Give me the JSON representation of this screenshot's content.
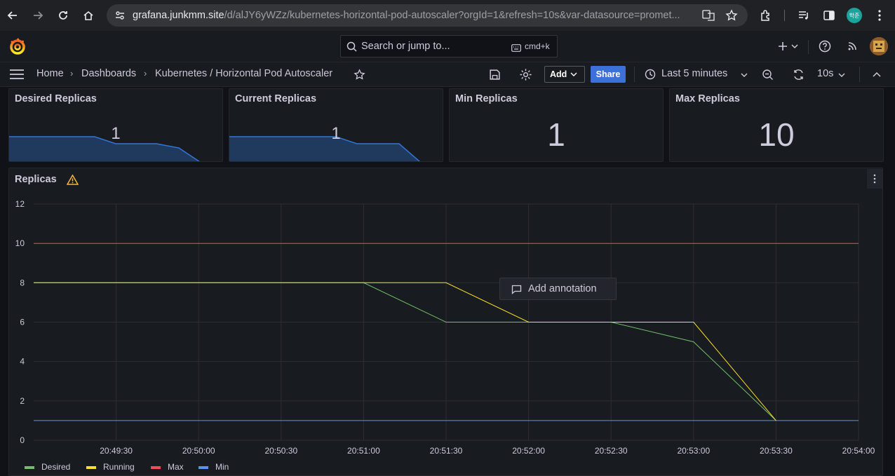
{
  "browser": {
    "url_host": "grafana.junkmm.site",
    "url_path": "/d/alJY6yWZz/kubernetes-horizontal-pod-autoscaler?orgId=1&refresh=10s&var-datasource=promet...",
    "profile_initials": "학준"
  },
  "topbar": {
    "search_placeholder": "Search or jump to...",
    "shortcut": "cmd+k"
  },
  "breadcrumbs": {
    "home": "Home",
    "dashboards": "Dashboards",
    "current": "Kubernetes / Horizontal Pod Autoscaler"
  },
  "toolbar": {
    "add_label": "Add",
    "share_label": "Share",
    "time_range": "Last 5 minutes",
    "refresh_interval": "10s"
  },
  "stats": [
    {
      "title": "Desired Replicas",
      "value": "1"
    },
    {
      "title": "Current Replicas",
      "value": "1"
    },
    {
      "title": "Min Replicas",
      "value": "1"
    },
    {
      "title": "Max Replicas",
      "value": "10"
    }
  ],
  "graph": {
    "title": "Replicas",
    "context_menu_item": "Add annotation",
    "legend": [
      "Desired",
      "Running",
      "Max",
      "Min"
    ]
  },
  "colors": {
    "desired": "#73bf69",
    "running": "#fade2a",
    "max": "#f2495c",
    "min": "#5794f2",
    "sparkline_fill": "#1f3a5c",
    "sparkline_line": "#3274d9"
  },
  "chart_data": {
    "type": "line",
    "title": "Replicas",
    "x": [
      "20:49:00",
      "20:49:30",
      "20:50:00",
      "20:50:30",
      "20:51:00",
      "20:51:30",
      "20:52:00",
      "20:52:30",
      "20:53:00",
      "20:53:30",
      "20:54:00"
    ],
    "x_ticks": [
      "20:49:30",
      "20:50:00",
      "20:50:30",
      "20:51:00",
      "20:51:30",
      "20:52:00",
      "20:52:30",
      "20:53:00",
      "20:53:30",
      "20:54:00"
    ],
    "y_ticks": [
      0,
      2,
      4,
      6,
      8,
      10,
      12
    ],
    "ylim": [
      0,
      12
    ],
    "series": [
      {
        "name": "Max",
        "x": [
          "20:49:00",
          "20:54:00"
        ],
        "values": [
          10,
          10
        ]
      },
      {
        "name": "Min",
        "x": [
          "20:49:00",
          "20:54:00"
        ],
        "values": [
          1,
          1
        ]
      },
      {
        "name": "Desired",
        "x": [
          "20:49:00",
          "20:51:00",
          "20:51:30",
          "20:52:00",
          "20:52:30",
          "20:53:00",
          "20:53:30"
        ],
        "values": [
          8,
          8,
          6,
          6,
          6,
          5,
          1
        ]
      },
      {
        "name": "Running",
        "x": [
          "20:49:00",
          "20:51:30",
          "20:52:00",
          "20:53:00",
          "20:53:30"
        ],
        "values": [
          8,
          8,
          6,
          6,
          1
        ]
      }
    ],
    "grid": true
  }
}
